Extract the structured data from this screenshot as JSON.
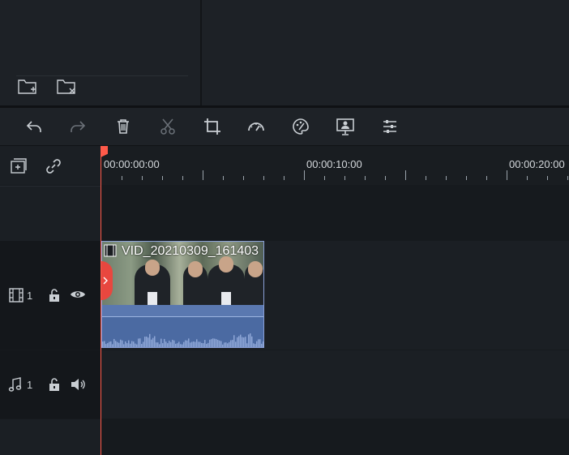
{
  "timecodes": [
    "00:00:00:00",
    "00:00:10:00",
    "00:00:20:00"
  ],
  "clip": {
    "title": "VID_20210309_161403"
  },
  "tracks": {
    "video": {
      "number": "1"
    },
    "audio": {
      "number": "1"
    }
  },
  "toolbar": {
    "icons": [
      "undo-icon",
      "redo-icon",
      "delete-icon",
      "cut-icon",
      "crop-icon",
      "speed-icon",
      "color-icon",
      "green-screen-icon",
      "adjust-icon"
    ]
  },
  "media_panel": {
    "icons": [
      "new-folder-icon",
      "delete-folder-icon"
    ]
  },
  "colors": {
    "playhead": "#ff5a4a",
    "clip_border": "#8aa0d8",
    "clip_audio": "#4b6aa2"
  }
}
